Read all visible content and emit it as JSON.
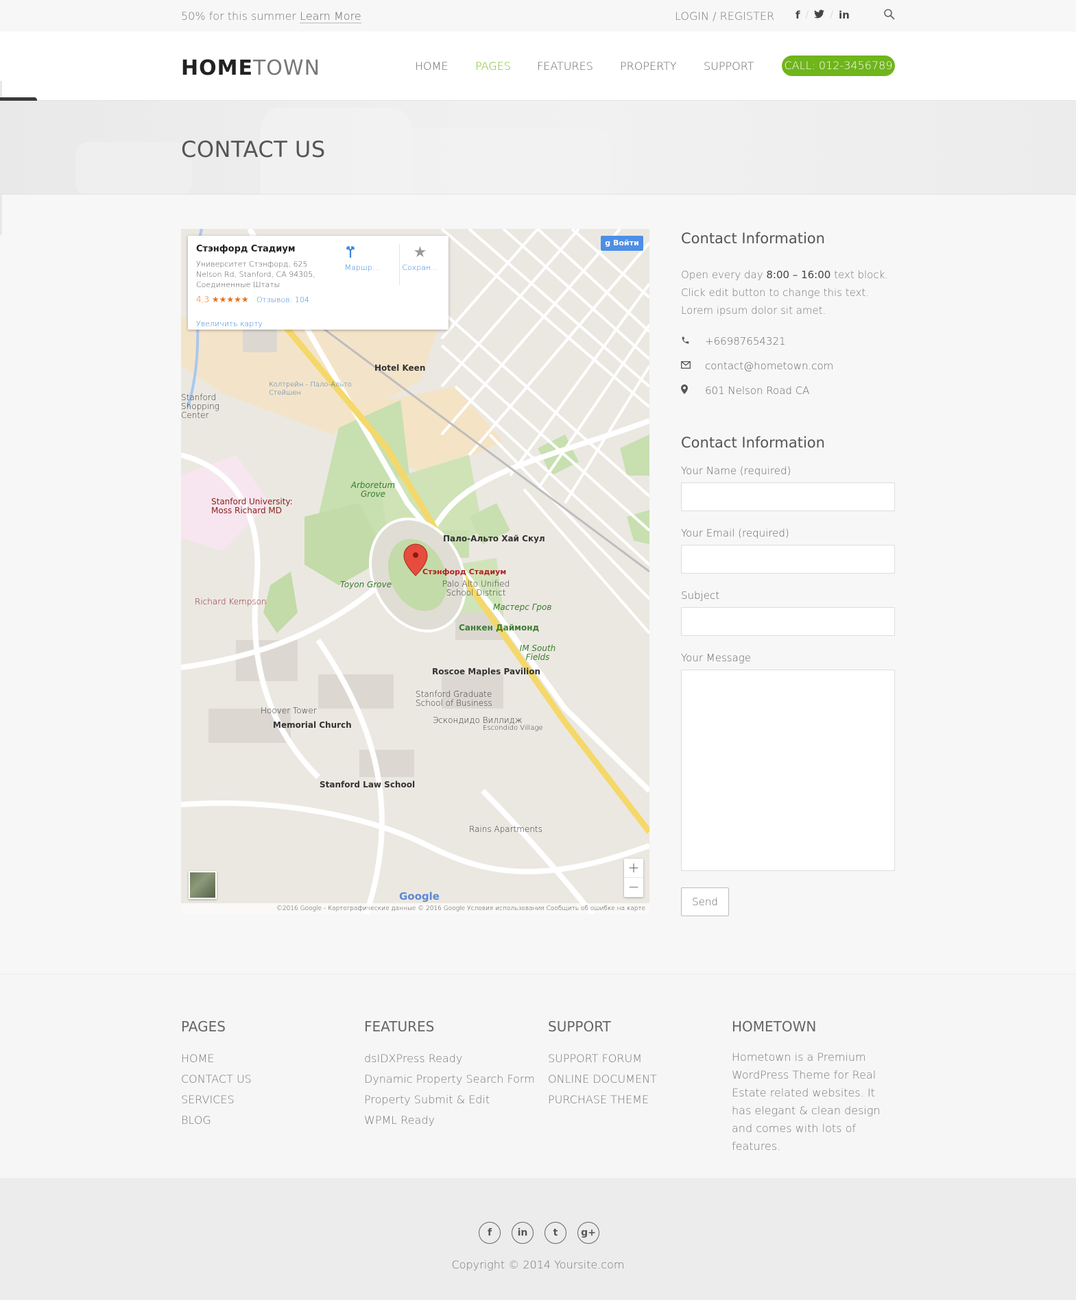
{
  "topbar": {
    "promo_text": "50% for this summer",
    "promo_link": "Learn More",
    "login": "LOGIN / REGISTER",
    "social": [
      "f",
      "t",
      "in"
    ]
  },
  "header": {
    "logo_bold": "HOME",
    "logo_light": "TOWN",
    "nav": [
      "HOME",
      "PAGES",
      "FEATURES",
      "PROPERTY",
      "SUPPORT"
    ],
    "active_nav": "PAGES",
    "call": "CALL: 012-3456789",
    "accent_color": "#6fb51c"
  },
  "hero": {
    "title": "CONTACT US"
  },
  "map": {
    "card_title": "Стэнфорд Стадиум",
    "card_address": "Университет Стэнфорд, 625 Nelson Rd, Stanford, CA 94305, Соединенные Штаты",
    "card_rating": "4,3 ★★★★★",
    "card_reviews": "Отзывов: 104",
    "card_enlarge": "Увеличить карту",
    "card_route": "Маршр...",
    "card_save": "Сохран...",
    "signin": "Войти",
    "zoom_in": "+",
    "zoom_out": "−",
    "google": "Google",
    "footer": "©2016 Google - Картографические данные © 2016 Google   Условия использования   Сообщить об ошибке на карте",
    "labels": {
      "hotel_keen": "Hotel Keen",
      "caltrain": "Колтрейн - Пало-Альто Стейшен",
      "stanford_center": "Stanford Shopping Center",
      "arboretum": "Arboretum Grove",
      "moss": "Stanford University: Moss Richard MD",
      "paloaltohigh": "Пало-Альто Хай Скул",
      "stadium": "Стэнфорд Стадиум",
      "toyon": "Toyon Grove",
      "unified": "Palo Alto Unified School District",
      "masters": "Мастерс Гров",
      "sunken": "Санкен Даймонд",
      "kempson": "Richard Kempson",
      "imsouth": "IM South Fields",
      "roscoe": "Roscoe Maples Pavilion",
      "gsb": "Stanford Graduate School of Business",
      "hoover": "Hoover Tower",
      "memorial": "Memorial Church",
      "escondido": "Эскондидо Виллидж",
      "escondido_en": "Escondido Village",
      "lawschool": "Stanford Law School",
      "rains": "Rains Apartments"
    }
  },
  "contact_info": {
    "heading": "Contact Information",
    "text_before": "Open every day",
    "hours": "8:00 – 16:00",
    "text_after": "text block. Click edit button to change this text. Lorem ipsum dolor sit amet.",
    "phone": "+66987654321",
    "email": "contact@hometown.com",
    "address": "601 Nelson Road CA"
  },
  "form": {
    "heading": "Contact Information",
    "name_label": "Your Name (required)",
    "email_label": "Your Email (required)",
    "subject_label": "Subject",
    "message_label": "Your Message",
    "send": "Send"
  },
  "footer": {
    "pages": {
      "title": "PAGES",
      "links": [
        "HOME",
        "CONTACT US",
        "SERVICES",
        "BLOG"
      ]
    },
    "features": {
      "title": "FEATURES",
      "links": [
        "dsIDXPress Ready",
        "Dynamic Property Search Form",
        "Property Submit & Edit",
        "WPML Ready"
      ]
    },
    "support": {
      "title": "SUPPORT",
      "links": [
        "SUPPORT FORUM",
        "ONLINE DOCUMENT",
        "PURCHASE THEME"
      ]
    },
    "about": {
      "title": "HOMETOWN",
      "text": "Hometown is a Premium WordPress Theme for Real Estate related websites. It has elegant & clean design and comes with lots of features."
    }
  },
  "bottom": {
    "social": [
      "f",
      "in",
      "t",
      "g+"
    ],
    "copyright": "Copyright © 2014 Yoursite.com"
  }
}
